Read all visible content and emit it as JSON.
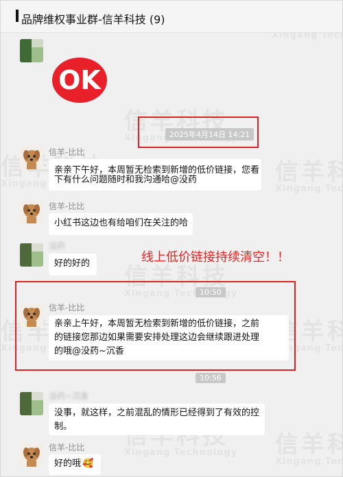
{
  "window": {
    "title": "品牌维权事业群-信羊科技 (9)"
  },
  "watermark": {
    "cn": "信羊科技",
    "en": "Xingang Technology"
  },
  "sticker": {
    "text": "OK",
    "color": "#e8202a"
  },
  "timestamps": {
    "t1": "2025年4月14日 14:21",
    "t2": "10:50",
    "t3": "10:56"
  },
  "annotation": "线上低价链接持续清空！！",
  "messages": [
    {
      "sender": "信羊-比比",
      "lines": [
        "亲亲下午好，本周暂无检索到新增的低价链接，您看",
        "下有什么问题随时和我沟通哈@没药"
      ]
    },
    {
      "sender": "信羊-比比",
      "lines": [
        "小红书这边也有给咱们在关注的哈"
      ]
    },
    {
      "sender": "没药",
      "lines": [
        "好的好的"
      ]
    },
    {
      "sender": "信羊-比比",
      "lines": [
        "亲亲上午好，本周暂无检索到新增的低价链接，之前",
        "的链接您那边如果需要安排处理这边会继续跟进处理",
        "的哦@没药~沉香"
      ]
    },
    {
      "sender": "没药~沉香",
      "lines": [
        "没事，就这样，之前混乱的情形已经得到了有效的控",
        "制。"
      ]
    },
    {
      "sender": "信羊-比比",
      "lines": [
        "好的哦"
      ],
      "emoji": "🥰"
    }
  ],
  "colors": {
    "highlight_red": "#e02020",
    "bubble_white": "#ffffff",
    "chat_background": "#f0f0f0"
  }
}
